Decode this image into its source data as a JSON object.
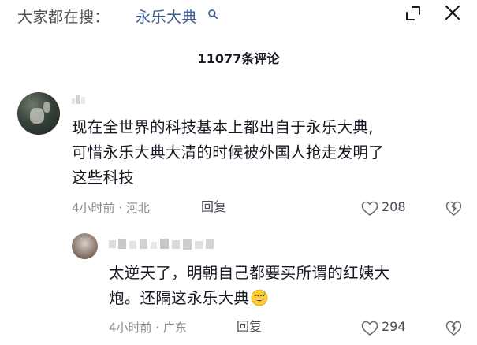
{
  "search_bar": {
    "prefix": "大家都在搜：",
    "term": "永乐大典",
    "search_icon": "search-icon"
  },
  "header": {
    "comment_count": "11077条评论",
    "collapse_icon": "collapse-icon",
    "close_icon": "close-icon"
  },
  "comments": [
    {
      "text_lines": [
        "现在全世界的科技基本上都出自于永乐大典,",
        "可惜永乐大典大清的时候被外国人抢走发明了",
        "这些科技"
      ],
      "meta": "4小时前 · 河北",
      "reply_label": "回复",
      "likes": "208"
    },
    {
      "text_lines": [
        "太逆天了，明朝自己都要买所谓的红姨大",
        "炮。还隔这永乐大典"
      ],
      "emoji": "sweat-smile-emoji",
      "meta": "4小时前 · 广东",
      "reply_label": "回复",
      "likes": "294"
    }
  ],
  "colors": {
    "link_blue": "#3a5c8f",
    "meta_gray": "#8a8b91",
    "text_dark": "#161823"
  }
}
